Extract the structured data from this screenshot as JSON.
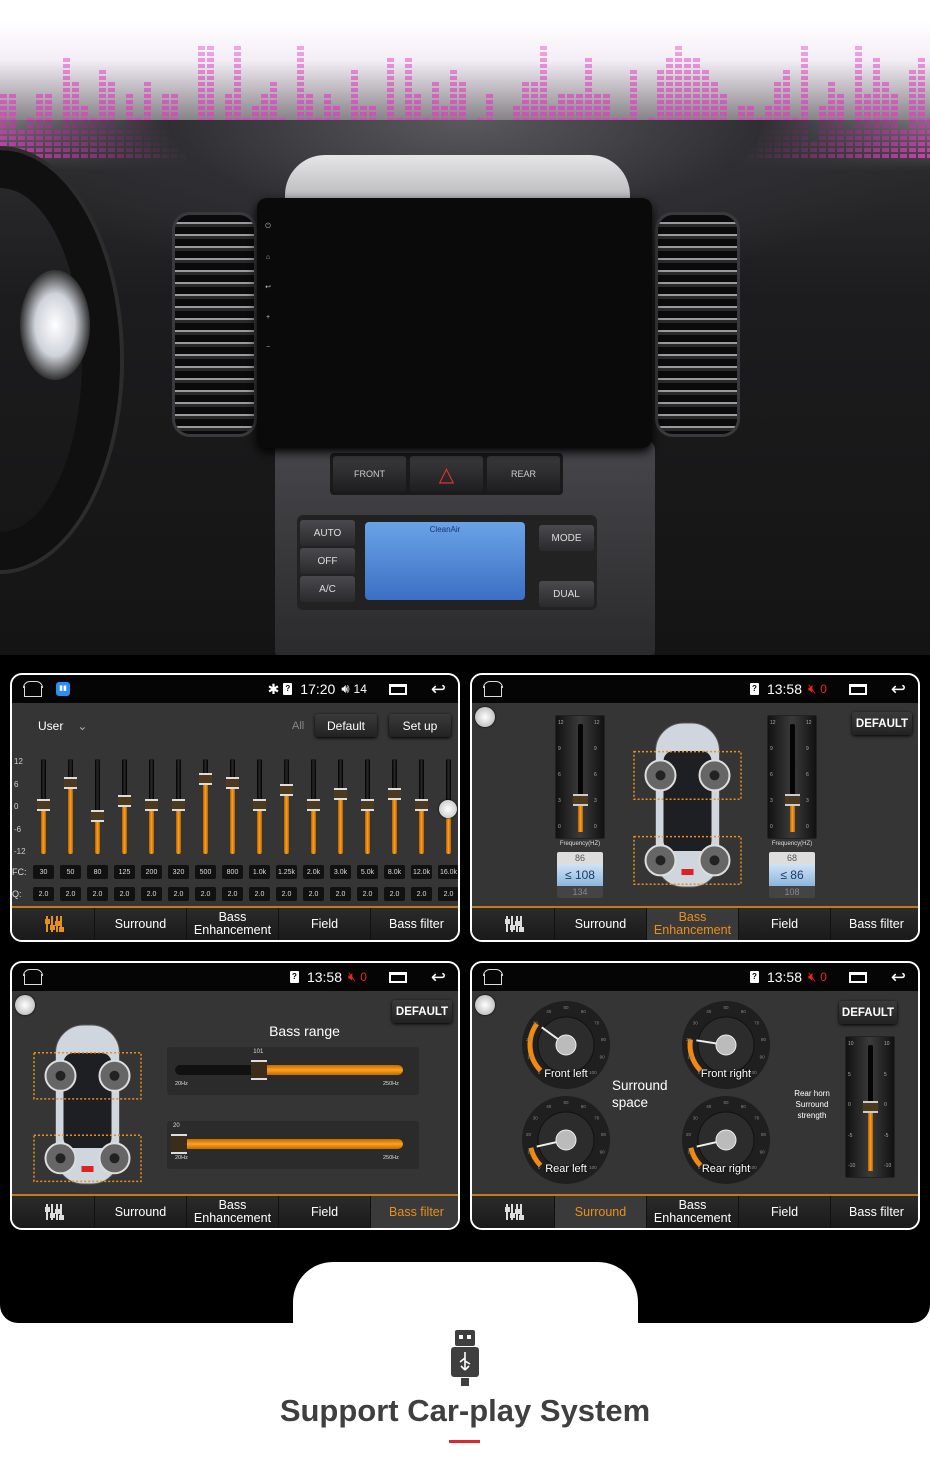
{
  "colors": {
    "accent": "#e8901c",
    "tab_line": "#c07a18",
    "mute_red": "#e22222",
    "banner_magenta": "#e040c0",
    "underline_red": "#e2262b"
  },
  "tabs": [
    "Surround",
    "Bass Enhancement",
    "Field",
    "Bass filter"
  ],
  "dashboard": {
    "climate_buttons": [
      "AUTO",
      "OFF",
      "A/C",
      "MODE",
      "DUAL"
    ],
    "climate_display": "CleanAir",
    "hazard_labels": [
      "FRONT",
      "REAR"
    ]
  },
  "eq_screen": {
    "status": {
      "time": "17:20",
      "volume": "14",
      "icons": [
        "home-icon",
        "app-icon",
        "bluetooth-icon",
        "sim-icon",
        "volume-icon",
        "recents-icon",
        "back-icon"
      ]
    },
    "preset": "User",
    "all_label": "All",
    "default_label": "Default",
    "setup_label": "Set up",
    "scale": [
      "12",
      "6",
      "0",
      "-6",
      "-12"
    ],
    "fc_label": "FC:",
    "q_label": "Q:",
    "bands": [
      {
        "fc": "30",
        "q": "2.0",
        "gain": 0
      },
      {
        "fc": "50",
        "q": "2.0",
        "gain": 6
      },
      {
        "fc": "80",
        "q": "2.0",
        "gain": -3
      },
      {
        "fc": "125",
        "q": "2.0",
        "gain": 1
      },
      {
        "fc": "200",
        "q": "2.0",
        "gain": 0
      },
      {
        "fc": "320",
        "q": "2.0",
        "gain": 0
      },
      {
        "fc": "500",
        "q": "2.0",
        "gain": 7
      },
      {
        "fc": "800",
        "q": "2.0",
        "gain": 6
      },
      {
        "fc": "1.0k",
        "q": "2.0",
        "gain": 0
      },
      {
        "fc": "1.25k",
        "q": "2.0",
        "gain": 4
      },
      {
        "fc": "2.0k",
        "q": "2.0",
        "gain": 0
      },
      {
        "fc": "3.0k",
        "q": "2.0",
        "gain": 3
      },
      {
        "fc": "5.0k",
        "q": "2.0",
        "gain": 0
      },
      {
        "fc": "8.0k",
        "q": "2.0",
        "gain": 3
      },
      {
        "fc": "12.0k",
        "q": "2.0",
        "gain": 0
      },
      {
        "fc": "16.0k",
        "q": "2.0",
        "gain": -1
      }
    ],
    "active_tab": "eq"
  },
  "bass_enh_screen": {
    "status": {
      "time": "13:58",
      "volume": "0"
    },
    "default_label": "DEFAULT",
    "scale": [
      "12",
      "9",
      "6",
      "3",
      "0"
    ],
    "freq_label": "Frequency(HZ)",
    "left": {
      "level": 3.5,
      "prev": "86",
      "value": "108",
      "next": "134"
    },
    "right": {
      "level": 3.5,
      "prev": "68",
      "value": "86",
      "next": "108"
    },
    "active_tab": "Bass Enhancement"
  },
  "bass_filter_screen": {
    "status": {
      "time": "13:58",
      "volume": "0"
    },
    "default_label": "DEFAULT",
    "title": "Bass range",
    "sliders": [
      {
        "value": "101",
        "min": "20Hz",
        "max": "250Hz",
        "v": 101
      },
      {
        "value": "20",
        "min": "20Hz",
        "max": "250Hz",
        "v": 20
      }
    ],
    "active_tab": "Bass filter"
  },
  "surround_screen": {
    "status": {
      "time": "13:58",
      "volume": "0"
    },
    "default_label": "DEFAULT",
    "space_label": "Surround space",
    "gauge_ticks": [
      "0",
      "10",
      "20",
      "30",
      "40",
      "50",
      "60",
      "70",
      "80",
      "90",
      "100"
    ],
    "gauges": [
      {
        "label": "Front left",
        "value": 30
      },
      {
        "label": "Front right",
        "value": 20
      },
      {
        "label": "Rear left",
        "value": 12
      },
      {
        "label": "Rear right",
        "value": 12
      }
    ],
    "strength_label": [
      "Rear horn",
      "Surround",
      "strength"
    ],
    "strength_scale": [
      "10",
      "5",
      "0",
      "-5",
      "-10"
    ],
    "strength": 0,
    "active_tab": "Surround"
  },
  "footer": {
    "title": "Support Car-play System",
    "icon": "usb-icon"
  }
}
